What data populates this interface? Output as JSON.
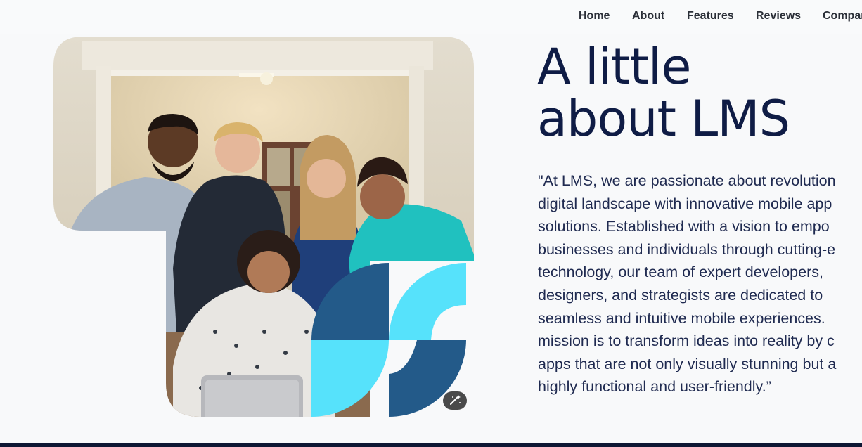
{
  "nav": {
    "items": [
      "Home",
      "About",
      "Features",
      "Reviews",
      "Compar"
    ]
  },
  "about": {
    "heading_lines": [
      "A little",
      "about LMS"
    ],
    "quote_lines": [
      "\"At LMS, we are passionate about revolution",
      "digital landscape with innovative mobile app",
      "solutions. Established with a vision to empo",
      "businesses and individuals through cutting-e",
      "technology, our team of expert developers,",
      "designers, and strategists are dedicated to",
      "seamless and intuitive mobile experiences.",
      "mission is to transform ideas into reality by c",
      "apps that are not only visually stunning but a",
      "highly functional and user-friendly.”"
    ]
  },
  "photo": {
    "icon": "team-photo",
    "accent_light": "#56e2fb",
    "accent_dark": "#235a89"
  },
  "edit_button": {
    "icon": "magic-wand-icon"
  },
  "colors": {
    "heading": "#0f1c45",
    "body_text": "#1f2a50",
    "nav_text": "#2b2f38",
    "background": "#f8f9fa",
    "footer": "#0e1733"
  }
}
